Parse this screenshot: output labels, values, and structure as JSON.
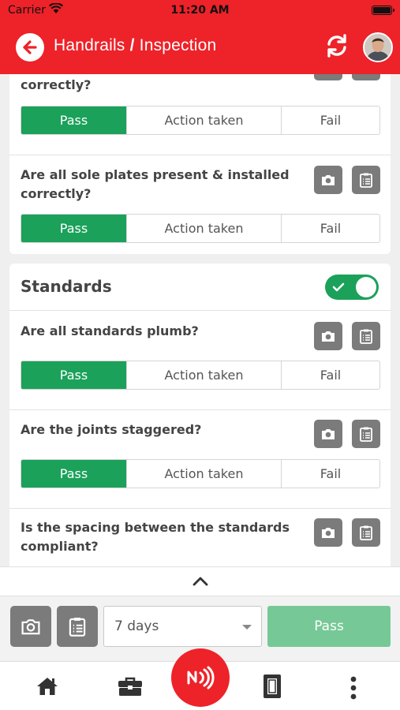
{
  "status": {
    "carrier": "Carrier",
    "time": "11:20 AM"
  },
  "header": {
    "title_part1": "Handrails",
    "title_sep": "/",
    "title_part2": "Inspection"
  },
  "options": {
    "pass": "Pass",
    "action": "Action taken",
    "fail": "Fail"
  },
  "top_card": {
    "partial_question": "correctly?",
    "question2": "Are all sole plates present & installed correctly?"
  },
  "standards": {
    "title": "Standards",
    "enabled": true,
    "questions": [
      "Are all standards plumb?",
      "Are the joints staggered?",
      "Is the spacing between the standards compliant?"
    ]
  },
  "footer": {
    "duration": "7 days",
    "pass_button": "Pass"
  },
  "colors": {
    "brand_red": "#ee2229",
    "pass_green": "#1ba15a",
    "icon_gray": "#7b7b7b"
  },
  "icons": [
    "back-arrow-icon",
    "sync-icon",
    "camera-icon",
    "clipboard-icon",
    "chevron-up-icon",
    "home-icon",
    "briefcase-icon",
    "nfc-icon",
    "tag-icon",
    "more-vertical-icon"
  ]
}
